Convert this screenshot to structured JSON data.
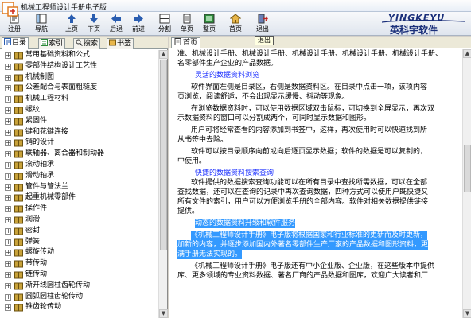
{
  "window": {
    "title": "机械工程师设计手册电子版"
  },
  "toolbar": {
    "buttons": [
      {
        "label": "注册",
        "icon": "register-icon"
      },
      {
        "label": "导航",
        "icon": "navigation-icon"
      },
      {
        "label": "上页",
        "icon": "page-up-icon"
      },
      {
        "label": "下页",
        "icon": "page-down-icon"
      },
      {
        "label": "后退",
        "icon": "back-arrow-icon"
      },
      {
        "label": "前进",
        "icon": "forward-arrow-icon"
      },
      {
        "label": "分割",
        "icon": "split-icon"
      },
      {
        "label": "单页",
        "icon": "single-page-icon"
      },
      {
        "label": "整页",
        "icon": "full-page-icon"
      },
      {
        "label": "首页",
        "icon": "home-icon"
      },
      {
        "label": "退出",
        "icon": "exit-icon"
      }
    ],
    "tooltip": "退出"
  },
  "brand": {
    "en": "YINGKEYU",
    "zh": "英科宇软件",
    "color": "#1a2f7a"
  },
  "left_panel": {
    "tabs": [
      {
        "label": "目录",
        "icon": "catalog-icon",
        "active": true
      },
      {
        "label": "索引",
        "icon": "index-icon",
        "active": false
      },
      {
        "label": "搜索",
        "icon": "search-icon",
        "active": false
      },
      {
        "label": "书签",
        "icon": "bookmark-icon",
        "active": false
      }
    ],
    "tree_items": [
      "常用基础资料和公式",
      "零部件结构设计工艺性",
      "机械制图",
      "公差配合与表面粗糙度",
      "机械工程材料",
      "螺纹",
      "紧固件",
      "键和花键连接",
      "销的设计",
      "联轴器、离合器和制动器",
      "滚动轴承",
      "滑动轴承",
      "管件与管法兰",
      "起重机械零部件",
      "操作件",
      "润滑",
      "密封",
      "弹簧",
      "螺旋传动",
      "带传动",
      "链传动",
      "渐开线圆柱齿轮传动",
      "圆弧圆柱齿轮传动",
      "锥齿轮传动"
    ]
  },
  "right_panel": {
    "tab": {
      "label": "首页",
      "icon": "page-icon"
    },
    "content": {
      "line01": "准、机械设计手册、机械设计手册、机械设计手册、机械设计手册、机械设计手册、",
      "line02": "名零部件生产企业的产品数据。",
      "heading1": "灵活的数据资料浏览",
      "line03": "软件界面左侧是目录区，右侧是数据资料区。在目录中点击一项，该项内容",
      "line04": "页浏览，阅读舒适，不会出现显示缓慢、抖动等现象。",
      "line05": "在浏览数据资料时，可以使用数据区域双击鼠标，可切换到全屏显示，再次双",
      "line06": "示数据资料的窗口可以分割成两个，可同时显示数据和图形。",
      "line07": "用户可将经常查看的内容添加到书签中，这样，再次使用时可以快速找到所",
      "line08": "从书签中去除。",
      "line09": "软件可以按目录顺序向前或向后逐页显示数据；软件的数据是可以复制的，",
      "line10": "中使用。",
      "heading2": "快捷的数据资料搜索查询",
      "line11": "软件提供的数据搜索查询功能可以在所有目录中查找所需数据，可以在全部",
      "line12": "查找数据，还可以在查询的记录中再次查询数据，四种方式可以使用户既快捷又",
      "line13": "所有文件的索引，用户可以方便浏览手册的全部内容。软件对相关数据提供链接",
      "line14": "提供。",
      "sel1": "动态的数据资料升级和软件服务",
      "sel2": "《机械工程师设计手册》电子版将根据国家和行业标准的更新而及时更新，",
      "sel3": "加新的内容，并逐步添加国内外著名零部件生产厂家的产品数据和图形资料，更",
      "sel4": "满手册无法实现的。",
      "line15": "《机械工程师设计手册》电子版还有中小企业版、企业版，在这些版本中提供",
      "line16": "库、更多领域的专业资料数据、著名厂商的产品数据和图库，欢迎广大读者和厂"
    }
  },
  "colors": {
    "link_heading": "#1e32ff",
    "selection": "#3399ff",
    "book_icon": "#c8a23a"
  }
}
